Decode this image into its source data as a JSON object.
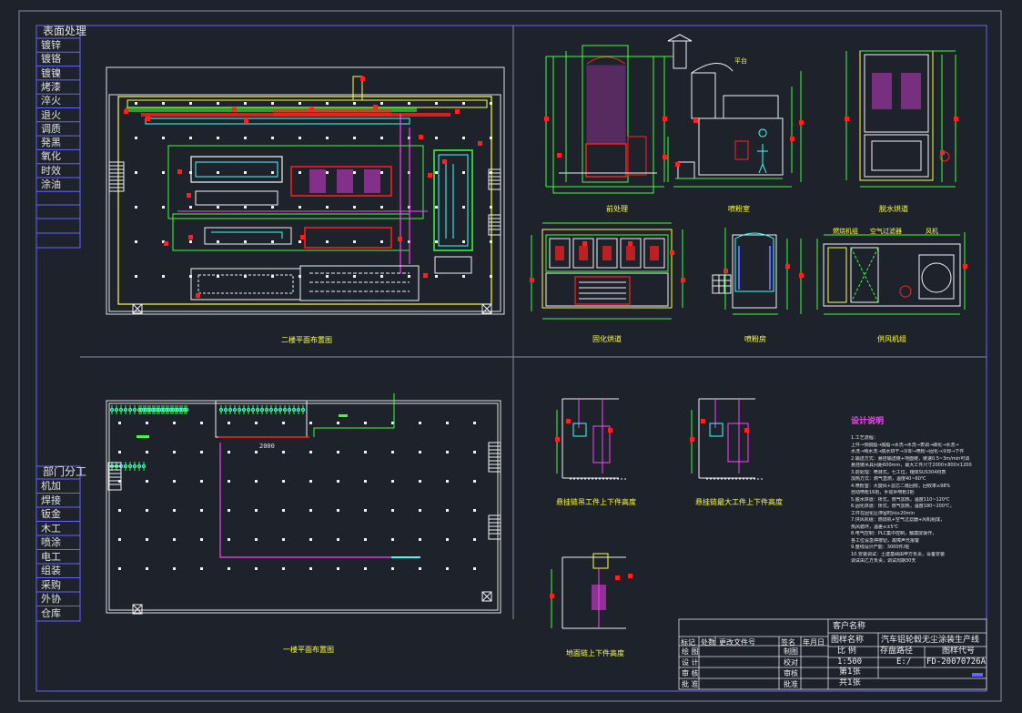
{
  "left_table": {
    "title": "表面处理",
    "items": [
      "镀锌",
      "镀铬",
      "镀镍",
      "烤漆",
      "淬火",
      "退火",
      "调质",
      "発黑",
      "氧化",
      "时效",
      "涂油"
    ]
  },
  "dept_table": {
    "title": "部门分工",
    "items": [
      "机加",
      "焊接",
      "钣金",
      "木工",
      "喷涂",
      "电工",
      "组装",
      "采购",
      "外协",
      "仓库"
    ]
  },
  "views": {
    "floor2_caption": "二楼平面布置图",
    "floor1_caption": "一楼平面布置图",
    "detail_captions": [
      "前处理",
      "喷粉室",
      "脱水烘道",
      "固化烘道",
      "喷粉房",
      "供风机组"
    ],
    "lift_captions": [
      "悬挂链吊工件上下件高度",
      "悬挂链最大工件上下件高度",
      "地面链上下件高度"
    ],
    "floor1_small_label": "2000",
    "callout_1": "平台",
    "fan_callouts": [
      "燃烧机组",
      "空气过滤器",
      "风机"
    ]
  },
  "notes": {
    "title": "设计说明",
    "lines": [
      "1.工艺流程：",
      "   上件→预脱脂→脱脂→水洗→水洗→表调→磷化→水洗→",
      "   水洗→纯水洗→脱水烘干→冷却→喷粉→固化→冷却→下件",
      "2.输送方式：悬挂输送链+地面链，链速0.5~3m/min可调",
      "   悬挂链吊具间距600mm，最大工件尺寸2000×800×1200",
      "3.前处理：喷淋式，七工位，槽体SUS304材质",
      "   加热方式：燃气直燃，温度40~60℃",
      "4.喷粉室：大旋风+滤芯二级回收，回收率≥98%",
      "   自动喷枪16把，手动补喷枪2把",
      "5.脱水烘道：桥式，燃气加热，温度110~120℃",
      "6.固化烘道：桥式，燃气加热，温度180~200℃，",
      "   工件在固化区停留时间≥20min",
      "7.供风机组：燃烧机+空气过滤器+风机组成，",
      "   热风循环，温差≤±5℃",
      "8.电气控制：PLC集中控制，触摸屏操作，",
      "   各工位设急停按钮，故障声光报警",
      "9.整线设计产能：3000件/班",
      "10.安装调试：土建基础由甲方负责，设备安装",
      "   调试由乙方负责，调试周期30天"
    ]
  },
  "title_block": {
    "client_label": "客户名称",
    "drawing_name_label": "图样名称",
    "drawing_name": "汽车铝轮毂无尘涂装生产线",
    "scale_label": "比 例",
    "scale": "1:500",
    "storage_label": "存盘路径",
    "storage": "E:/",
    "code_label": "图样代号",
    "code": "FD-20070726A",
    "sheet": "第1张",
    "total": "共1张",
    "rev_headers": [
      "标记",
      "处数",
      "更改文件号",
      "签名",
      "年月日"
    ],
    "role_rows": [
      "绘 图",
      "设 计",
      "审 核",
      "批 准"
    ],
    "sign_rows": [
      "制图",
      "校对",
      "审核",
      "批准"
    ]
  },
  "colors": {
    "bg": "#1e232b",
    "border": "#c8c8c8",
    "frame_blue": "#6464ff",
    "yellow": "#ffff3c",
    "green": "#3cff3c",
    "red": "#ff2020",
    "cyan": "#3cffff",
    "magenta": "#ff40ff",
    "white": "#f0f0f0"
  }
}
